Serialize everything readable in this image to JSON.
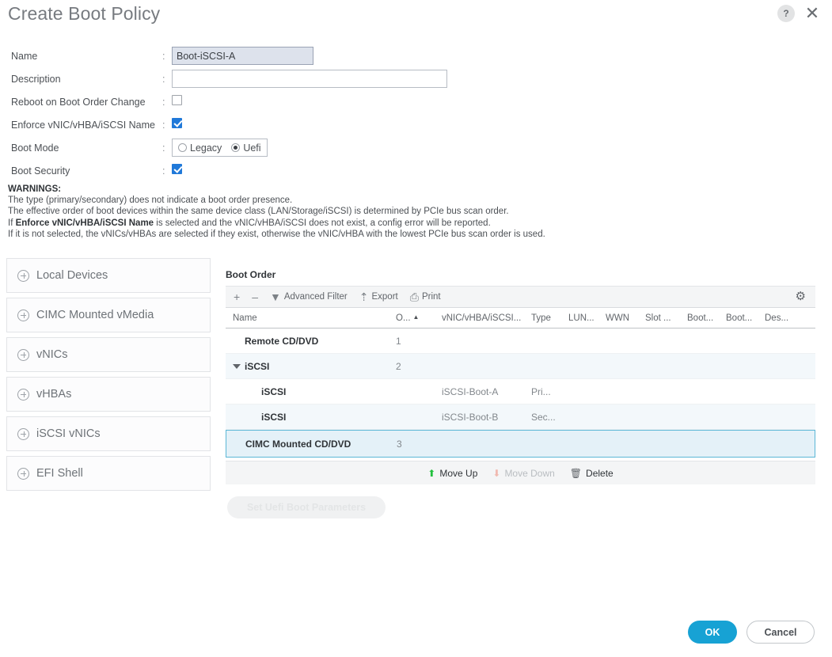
{
  "dialog": {
    "title": "Create Boot Policy",
    "help_icon": "help-icon",
    "close_icon": "close-icon"
  },
  "form": {
    "colon": ":",
    "rows": [
      {
        "label": "Name",
        "type": "text",
        "value": "Boot-iSCSI-A",
        "placeholder": ""
      },
      {
        "label": "Description",
        "type": "text",
        "value": "",
        "placeholder": ""
      },
      {
        "label": "Reboot on Boot Order Change",
        "type": "checkbox",
        "checked": false
      },
      {
        "label": "Enforce vNIC/vHBA/iSCSI Name",
        "type": "checkbox",
        "checked": true
      },
      {
        "label": "Boot Mode",
        "type": "radio",
        "options": [
          "Legacy",
          "Uefi"
        ],
        "selected": "Uefi"
      },
      {
        "label": "Boot Security",
        "type": "checkbox",
        "checked": true
      }
    ]
  },
  "warnings": {
    "heading": "WARNINGS:",
    "lines": [
      "The type (primary/secondary) does not indicate a boot order presence.",
      "The effective order of boot devices within the same device class (LAN/Storage/iSCSI) is determined by PCIe bus scan order.",
      "If it is not selected, the vNICs/vHBAs are selected if they exist, otherwise the vNIC/vHBA with the lowest PCIe bus scan order is used."
    ],
    "bold_line": {
      "prefix": "If ",
      "bold": "Enforce vNIC/vHBA/iSCSI Name",
      "suffix": " is selected and the vNIC/vHBA/iSCSI does not exist, a config error will be reported."
    }
  },
  "device_accordion": {
    "items": [
      {
        "label": "Local Devices"
      },
      {
        "label": "CIMC Mounted vMedia"
      },
      {
        "label": "vNICs"
      },
      {
        "label": "vHBAs"
      },
      {
        "label": "iSCSI vNICs"
      },
      {
        "label": "EFI Shell"
      }
    ]
  },
  "boot_order": {
    "title": "Boot Order",
    "toolbar": {
      "add_label": "+",
      "remove_label": "–",
      "advanced_filter_label": "Advanced Filter",
      "export_label": "Export",
      "print_label": "Print",
      "settings_icon": "gear-icon"
    },
    "columns": [
      "Name",
      "O...",
      "vNIC/vHBA/iSCSI...",
      "Type",
      "LUN...",
      "WWN",
      "Slot ...",
      "Boot...",
      "Boot...",
      "Des..."
    ],
    "sort_column": "O...",
    "sort_direction": "asc",
    "rows": [
      {
        "name": "Remote CD/DVD",
        "order": "1",
        "vnic": "",
        "type": "",
        "lun": "",
        "wwn": "",
        "slot": "",
        "boot1": "",
        "boot2": "",
        "desc": "",
        "indent": 0,
        "expander": false,
        "selected": false,
        "alt": false
      },
      {
        "name": "iSCSI",
        "order": "2",
        "vnic": "",
        "type": "",
        "lun": "",
        "wwn": "",
        "slot": "",
        "boot1": "",
        "boot2": "",
        "desc": "",
        "indent": 0,
        "expander": true,
        "selected": false,
        "alt": true
      },
      {
        "name": "iSCSI",
        "order": "",
        "vnic": "iSCSI-Boot-A",
        "type": "Pri...",
        "lun": "",
        "wwn": "",
        "slot": "",
        "boot1": "",
        "boot2": "",
        "desc": "",
        "indent": 1,
        "expander": false,
        "selected": false,
        "alt": false
      },
      {
        "name": "iSCSI",
        "order": "",
        "vnic": "iSCSI-Boot-B",
        "type": "Sec...",
        "lun": "",
        "wwn": "",
        "slot": "",
        "boot1": "",
        "boot2": "",
        "desc": "",
        "indent": 1,
        "expander": false,
        "selected": false,
        "alt": true
      },
      {
        "name": "CIMC Mounted CD/DVD",
        "order": "3",
        "vnic": "",
        "type": "",
        "lun": "",
        "wwn": "",
        "slot": "",
        "boot1": "",
        "boot2": "",
        "desc": "",
        "indent": 0,
        "expander": false,
        "selected": true,
        "alt": false
      }
    ],
    "actions": [
      {
        "label": "Move Up",
        "icon": "arrow-up-icon",
        "enabled": true
      },
      {
        "label": "Move Down",
        "icon": "arrow-down-icon",
        "enabled": false
      },
      {
        "label": "Delete",
        "icon": "trash-icon",
        "enabled": true
      }
    ],
    "uefi_button": {
      "label": "Set Uefi Boot Parameters",
      "enabled": false
    }
  },
  "footer": {
    "ok_label": "OK",
    "cancel_label": "Cancel"
  },
  "colors": {
    "accent": "#17a2d4",
    "checkbox_on": "#2079d9",
    "selected_row_border": "#5bb7d6",
    "selected_row_bg": "#e4f1f8",
    "name_field_bg": "#dde2ec",
    "move_up_icon": "#22c03e"
  }
}
